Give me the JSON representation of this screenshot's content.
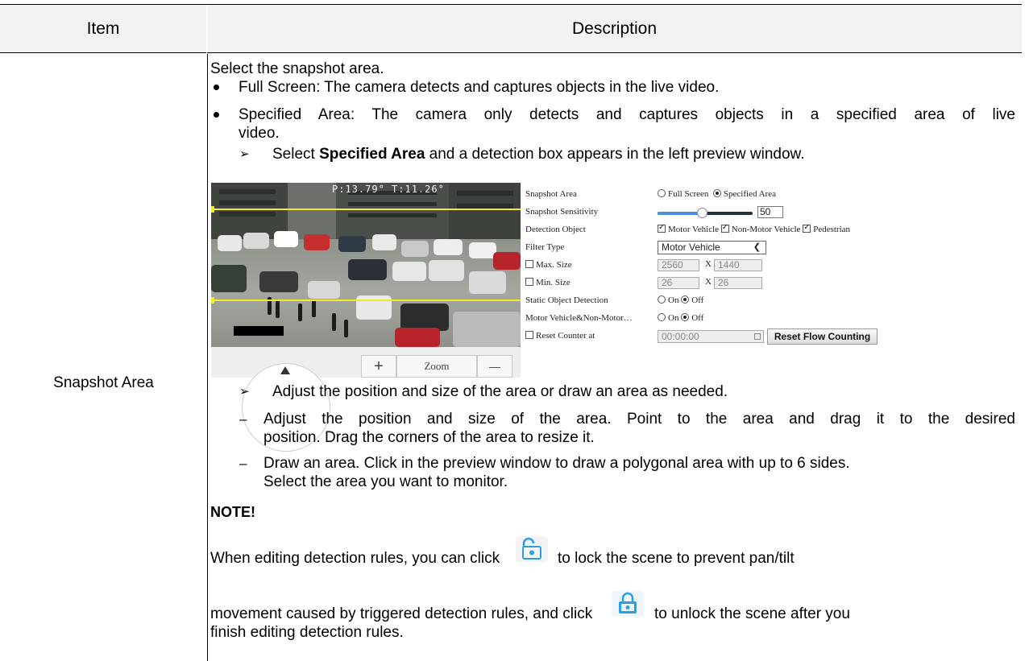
{
  "table": {
    "headers": [
      "Item",
      "Description"
    ],
    "row_item": "Snapshot Area"
  },
  "desc": {
    "intro": "Select the snapshot area.",
    "bullet1": "Full Screen: The camera detects and captures objects in the live video.",
    "bullet2_line1": "Specified Area: The camera only detects and captures objects in a specified area of live",
    "bullet2_line2": "video.",
    "sub1_pre": "Select ",
    "sub1_bold": "Specified Area",
    "sub1_post": " and a detection box appears in the left preview window.",
    "sub2": "Adjust the position and size of the area or draw an area as needed.",
    "dash1_line1": "Adjust the position and size of the area. Point to the area and drag it to the desired",
    "dash1_line2": "position. Drag the corners of the area to resize it.",
    "dash2_line1": "Draw an area. Click in the preview window to draw a polygonal area with up to 6 sides.",
    "dash2_line2": "Select the area you want to monitor.",
    "note_title": "NOTE!",
    "note_line1_pre": "When editing detection rules, you can click",
    "note_line1_post": "to lock the scene to prevent pan/tilt",
    "note_line2_pre": "movement caused by triggered detection rules, and click",
    "note_line2_post": "to unlock the scene after you",
    "note_line3": "finish editing detection rules."
  },
  "preview": {
    "overlay_text": "P:13.79°  T:11.26°",
    "zoom_plus": "+",
    "zoom_label": "Zoom",
    "zoom_minus": "—"
  },
  "form": {
    "snapshot_area_label": "Snapshot Area",
    "opt_full": "Full Screen",
    "opt_specified": "Specified Area",
    "sensitivity_label": "Snapshot Sensitivity",
    "sensitivity_value": "50",
    "sensitivity_fraction": 0.47,
    "detection_object_label": "Detection Object",
    "obj_motor": "Motor Vehicle",
    "obj_nonmotor": "Non-Motor Vehicle",
    "obj_ped": "Pedestrian",
    "filter_label": "Filter Type",
    "filter_value": "Motor Vehicle",
    "max_label": "Max. Size",
    "max_w": "2560",
    "max_h": "1440",
    "min_label": "Min. Size",
    "min_w": "26",
    "min_h": "26",
    "x_sep": "X",
    "static_label": "Static Object Detection",
    "opt_on": "On",
    "opt_off": "Off",
    "mv_label": "Motor Vehicle&Non-Motor…",
    "reset_label": "Reset Counter at",
    "reset_time": "00:00:00",
    "reset_button": "Reset Flow Counting"
  },
  "icons": {
    "unlocked": "lock-open-icon",
    "locked": "lock-closed-icon",
    "lock_color": "#2aa0e0"
  }
}
